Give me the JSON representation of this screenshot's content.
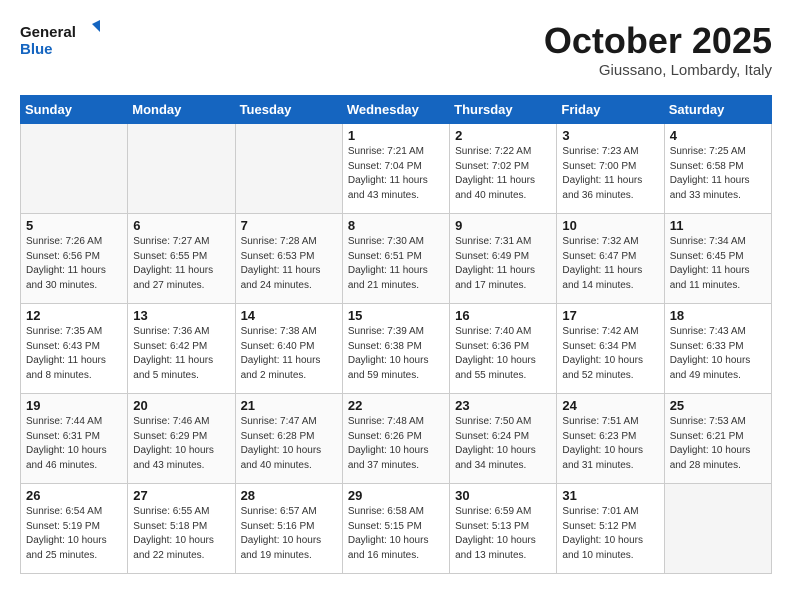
{
  "header": {
    "logo_line1": "General",
    "logo_line2": "Blue",
    "month_title": "October 2025",
    "subtitle": "Giussano, Lombardy, Italy"
  },
  "weekdays": [
    "Sunday",
    "Monday",
    "Tuesday",
    "Wednesday",
    "Thursday",
    "Friday",
    "Saturday"
  ],
  "weeks": [
    [
      {
        "day": "",
        "empty": true
      },
      {
        "day": "",
        "empty": true
      },
      {
        "day": "",
        "empty": true
      },
      {
        "day": "1",
        "sunrise": "Sunrise: 7:21 AM",
        "sunset": "Sunset: 7:04 PM",
        "daylight": "Daylight: 11 hours and 43 minutes."
      },
      {
        "day": "2",
        "sunrise": "Sunrise: 7:22 AM",
        "sunset": "Sunset: 7:02 PM",
        "daylight": "Daylight: 11 hours and 40 minutes."
      },
      {
        "day": "3",
        "sunrise": "Sunrise: 7:23 AM",
        "sunset": "Sunset: 7:00 PM",
        "daylight": "Daylight: 11 hours and 36 minutes."
      },
      {
        "day": "4",
        "sunrise": "Sunrise: 7:25 AM",
        "sunset": "Sunset: 6:58 PM",
        "daylight": "Daylight: 11 hours and 33 minutes."
      }
    ],
    [
      {
        "day": "5",
        "sunrise": "Sunrise: 7:26 AM",
        "sunset": "Sunset: 6:56 PM",
        "daylight": "Daylight: 11 hours and 30 minutes."
      },
      {
        "day": "6",
        "sunrise": "Sunrise: 7:27 AM",
        "sunset": "Sunset: 6:55 PM",
        "daylight": "Daylight: 11 hours and 27 minutes."
      },
      {
        "day": "7",
        "sunrise": "Sunrise: 7:28 AM",
        "sunset": "Sunset: 6:53 PM",
        "daylight": "Daylight: 11 hours and 24 minutes."
      },
      {
        "day": "8",
        "sunrise": "Sunrise: 7:30 AM",
        "sunset": "Sunset: 6:51 PM",
        "daylight": "Daylight: 11 hours and 21 minutes."
      },
      {
        "day": "9",
        "sunrise": "Sunrise: 7:31 AM",
        "sunset": "Sunset: 6:49 PM",
        "daylight": "Daylight: 11 hours and 17 minutes."
      },
      {
        "day": "10",
        "sunrise": "Sunrise: 7:32 AM",
        "sunset": "Sunset: 6:47 PM",
        "daylight": "Daylight: 11 hours and 14 minutes."
      },
      {
        "day": "11",
        "sunrise": "Sunrise: 7:34 AM",
        "sunset": "Sunset: 6:45 PM",
        "daylight": "Daylight: 11 hours and 11 minutes."
      }
    ],
    [
      {
        "day": "12",
        "sunrise": "Sunrise: 7:35 AM",
        "sunset": "Sunset: 6:43 PM",
        "daylight": "Daylight: 11 hours and 8 minutes."
      },
      {
        "day": "13",
        "sunrise": "Sunrise: 7:36 AM",
        "sunset": "Sunset: 6:42 PM",
        "daylight": "Daylight: 11 hours and 5 minutes."
      },
      {
        "day": "14",
        "sunrise": "Sunrise: 7:38 AM",
        "sunset": "Sunset: 6:40 PM",
        "daylight": "Daylight: 11 hours and 2 minutes."
      },
      {
        "day": "15",
        "sunrise": "Sunrise: 7:39 AM",
        "sunset": "Sunset: 6:38 PM",
        "daylight": "Daylight: 10 hours and 59 minutes."
      },
      {
        "day": "16",
        "sunrise": "Sunrise: 7:40 AM",
        "sunset": "Sunset: 6:36 PM",
        "daylight": "Daylight: 10 hours and 55 minutes."
      },
      {
        "day": "17",
        "sunrise": "Sunrise: 7:42 AM",
        "sunset": "Sunset: 6:34 PM",
        "daylight": "Daylight: 10 hours and 52 minutes."
      },
      {
        "day": "18",
        "sunrise": "Sunrise: 7:43 AM",
        "sunset": "Sunset: 6:33 PM",
        "daylight": "Daylight: 10 hours and 49 minutes."
      }
    ],
    [
      {
        "day": "19",
        "sunrise": "Sunrise: 7:44 AM",
        "sunset": "Sunset: 6:31 PM",
        "daylight": "Daylight: 10 hours and 46 minutes."
      },
      {
        "day": "20",
        "sunrise": "Sunrise: 7:46 AM",
        "sunset": "Sunset: 6:29 PM",
        "daylight": "Daylight: 10 hours and 43 minutes."
      },
      {
        "day": "21",
        "sunrise": "Sunrise: 7:47 AM",
        "sunset": "Sunset: 6:28 PM",
        "daylight": "Daylight: 10 hours and 40 minutes."
      },
      {
        "day": "22",
        "sunrise": "Sunrise: 7:48 AM",
        "sunset": "Sunset: 6:26 PM",
        "daylight": "Daylight: 10 hours and 37 minutes."
      },
      {
        "day": "23",
        "sunrise": "Sunrise: 7:50 AM",
        "sunset": "Sunset: 6:24 PM",
        "daylight": "Daylight: 10 hours and 34 minutes."
      },
      {
        "day": "24",
        "sunrise": "Sunrise: 7:51 AM",
        "sunset": "Sunset: 6:23 PM",
        "daylight": "Daylight: 10 hours and 31 minutes."
      },
      {
        "day": "25",
        "sunrise": "Sunrise: 7:53 AM",
        "sunset": "Sunset: 6:21 PM",
        "daylight": "Daylight: 10 hours and 28 minutes."
      }
    ],
    [
      {
        "day": "26",
        "sunrise": "Sunrise: 6:54 AM",
        "sunset": "Sunset: 5:19 PM",
        "daylight": "Daylight: 10 hours and 25 minutes."
      },
      {
        "day": "27",
        "sunrise": "Sunrise: 6:55 AM",
        "sunset": "Sunset: 5:18 PM",
        "daylight": "Daylight: 10 hours and 22 minutes."
      },
      {
        "day": "28",
        "sunrise": "Sunrise: 6:57 AM",
        "sunset": "Sunset: 5:16 PM",
        "daylight": "Daylight: 10 hours and 19 minutes."
      },
      {
        "day": "29",
        "sunrise": "Sunrise: 6:58 AM",
        "sunset": "Sunset: 5:15 PM",
        "daylight": "Daylight: 10 hours and 16 minutes."
      },
      {
        "day": "30",
        "sunrise": "Sunrise: 6:59 AM",
        "sunset": "Sunset: 5:13 PM",
        "daylight": "Daylight: 10 hours and 13 minutes."
      },
      {
        "day": "31",
        "sunrise": "Sunrise: 7:01 AM",
        "sunset": "Sunset: 5:12 PM",
        "daylight": "Daylight: 10 hours and 10 minutes."
      },
      {
        "day": "",
        "empty": true
      }
    ]
  ]
}
